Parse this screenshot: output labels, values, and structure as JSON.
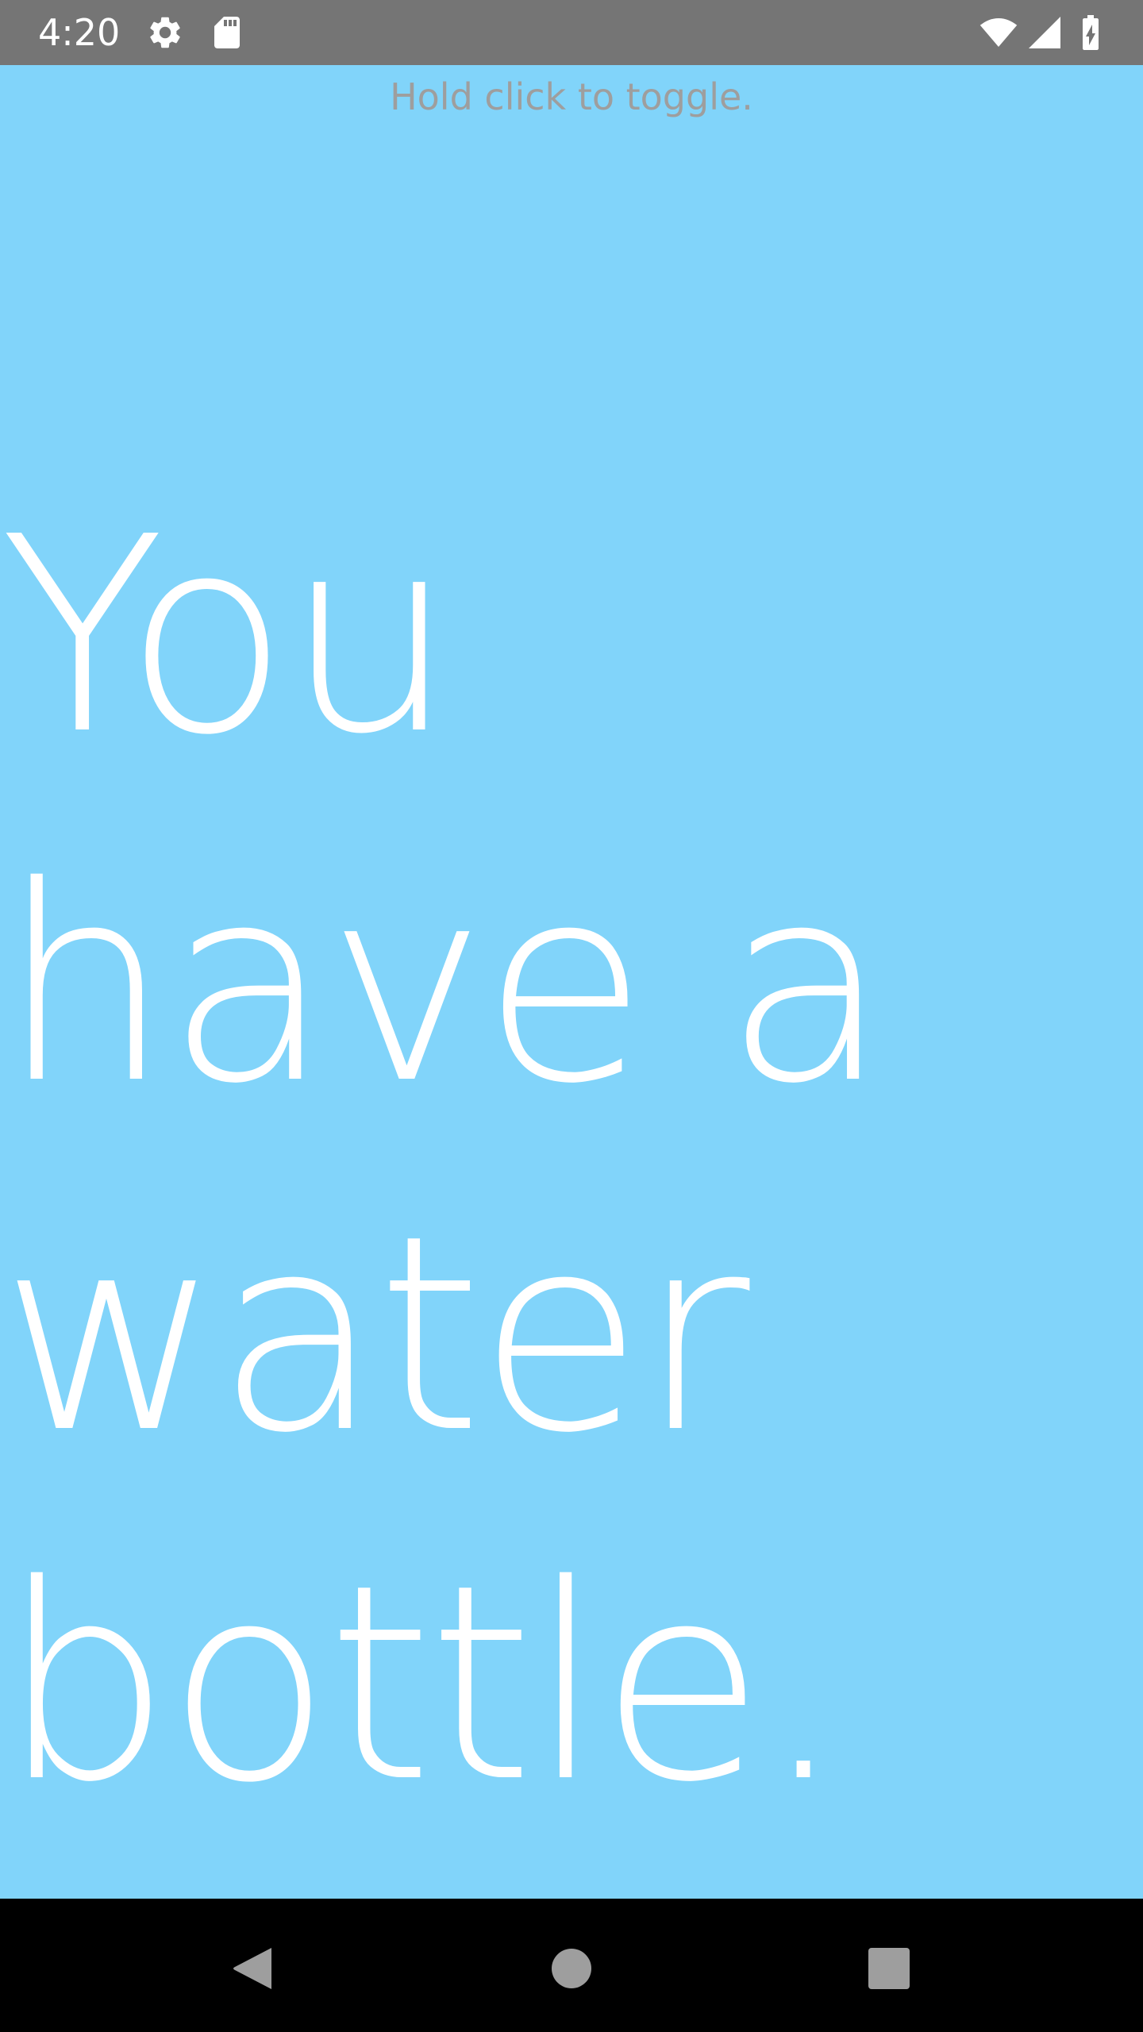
{
  "status_bar": {
    "time": "4:20",
    "icons": [
      "gear-icon",
      "sd-card-icon",
      "wifi-icon",
      "cell-signal-icon",
      "battery-charging-icon"
    ],
    "background": "#757575"
  },
  "app": {
    "background": "#81d4fa",
    "hint": "Hold click to toggle.",
    "message": "You have a water bottle."
  },
  "nav_bar": {
    "buttons": [
      "back-icon",
      "home-icon",
      "recents-icon"
    ]
  }
}
